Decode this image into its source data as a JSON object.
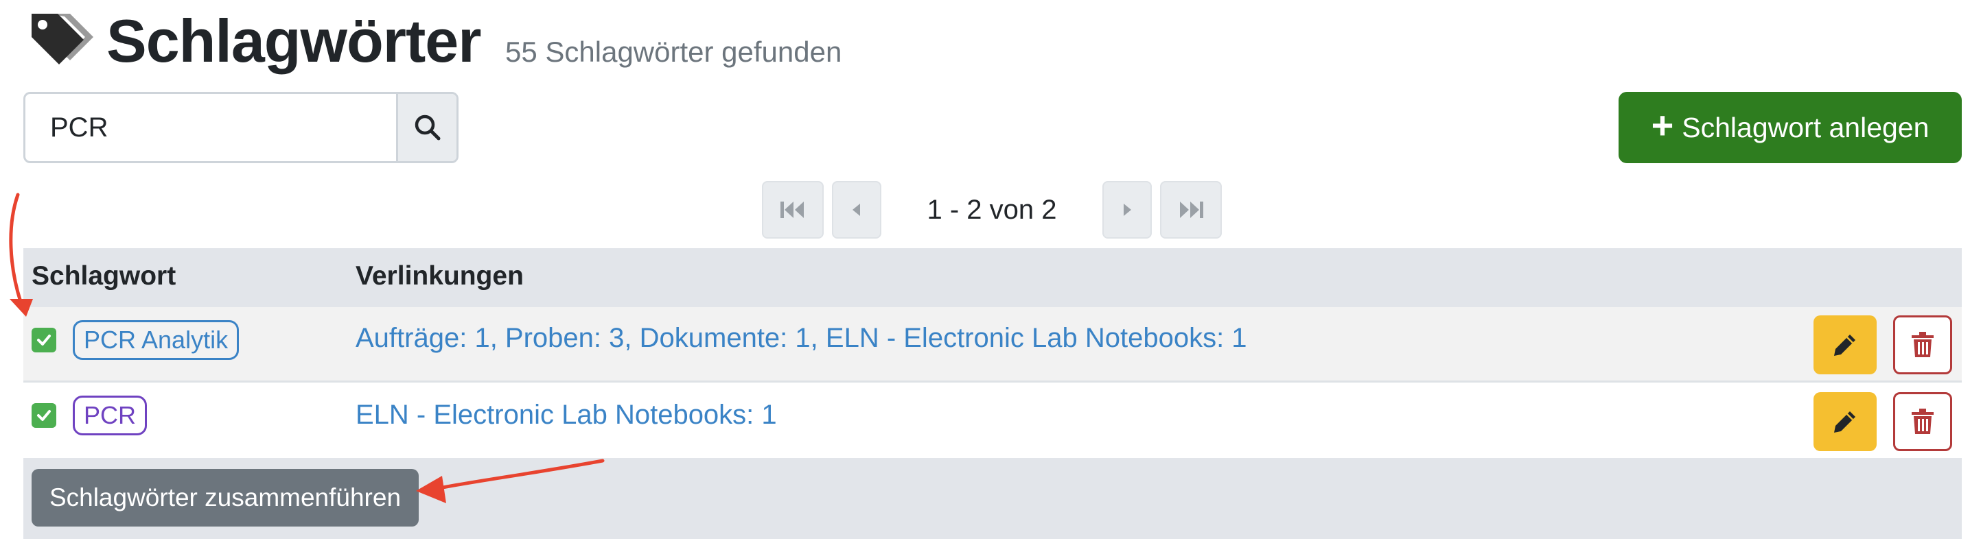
{
  "header": {
    "title": "Schlagwörter",
    "result_count": "55 Schlagwörter gefunden",
    "icon": "tags-icon"
  },
  "search": {
    "value": "PCR",
    "placeholder": "",
    "button_icon": "search-icon"
  },
  "actions": {
    "add_label": "Schlagwort anlegen",
    "add_icon": "plus-icon",
    "merge_label": "Schlagwörter zusammenführen"
  },
  "pagination": {
    "info": "1 - 2 von 2",
    "icons": [
      "first-page-icon",
      "prev-page-icon",
      "next-page-icon",
      "last-page-icon"
    ]
  },
  "table": {
    "headers": {
      "tag": "Schlagwort",
      "links": "Verlinkungen"
    },
    "rows": [
      {
        "checked": true,
        "tag": "PCR Analytik",
        "tag_color": "#3a83c6",
        "links": [
          "Aufträge: 1",
          "Proben: 3",
          "Dokumente: 1",
          "ELN - Electronic Lab Notebooks: 1"
        ]
      },
      {
        "checked": true,
        "tag": "PCR",
        "tag_color": "#6f42c1",
        "links": [
          "ELN - Electronic Lab Notebooks: 1"
        ]
      }
    ]
  },
  "colors": {
    "primary_green": "#2e7d1f",
    "link_blue": "#3a83c6",
    "edit_yellow": "#f5bf30",
    "delete_red": "#b33a3a",
    "annotation_red": "#e8432f",
    "header_gray": "#e2e5ea"
  }
}
